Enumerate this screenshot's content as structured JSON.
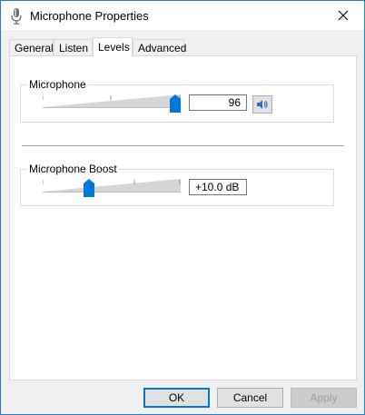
{
  "window": {
    "title": "Microphone Properties"
  },
  "tabs": [
    {
      "label": "General",
      "active": false
    },
    {
      "label": "Listen",
      "active": false
    },
    {
      "label": "Levels",
      "active": true
    },
    {
      "label": "Advanced",
      "active": false
    }
  ],
  "microphone": {
    "label": "Microphone",
    "value": "96",
    "level": 0.96
  },
  "boost": {
    "label": "Microphone Boost",
    "value": "+10.0 dB",
    "level": 0.333
  },
  "buttons": {
    "ok": "OK",
    "cancel": "Cancel",
    "apply": "Apply"
  },
  "colors": {
    "accent": "#0078d7",
    "border": "#1c7fd6"
  }
}
